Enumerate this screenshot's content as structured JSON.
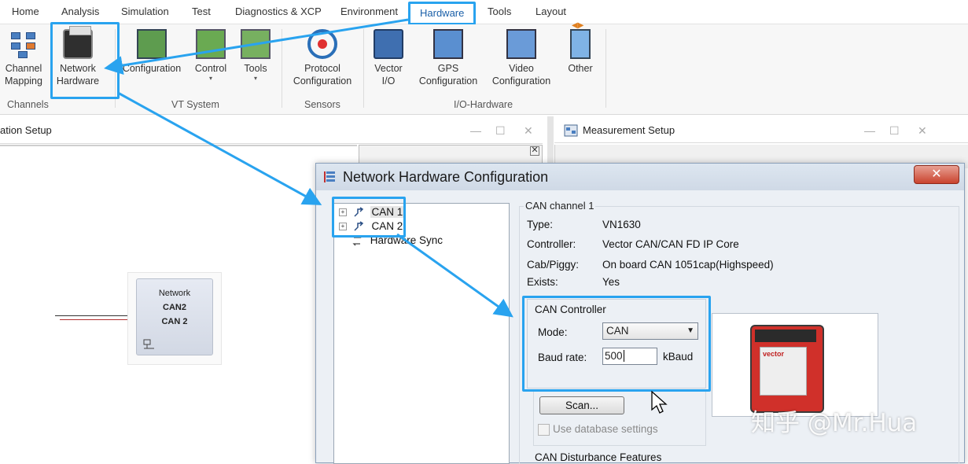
{
  "menu": {
    "items": [
      "Home",
      "Analysis",
      "Simulation",
      "Test",
      "Diagnostics & XCP",
      "Environment",
      "Hardware",
      "Tools",
      "Layout"
    ],
    "active": "Hardware"
  },
  "ribbon": {
    "channel_mapping": [
      "Channel",
      "Mapping"
    ],
    "network_hardware": [
      "Network",
      "Hardware"
    ],
    "configuration": "Configuration",
    "control": "Control",
    "tools": "Tools",
    "protocol_configuration": [
      "Protocol",
      "Configuration"
    ],
    "vector_io": [
      "Vector",
      "I/O"
    ],
    "gps_configuration": [
      "GPS",
      "Configuration"
    ],
    "video_configuration": [
      "Video",
      "Configuration"
    ],
    "other": "Other",
    "groups": {
      "channels": "Channels",
      "vt_system": "VT System",
      "sensors": "Sensors",
      "io_hardware": "I/O-Hardware"
    },
    "dropdown_caret": "▾"
  },
  "windows": {
    "simulation_setup_title": "ation Setup",
    "measurement_setup_title": "Measurement Setup",
    "min": "—",
    "max": "☐",
    "close": "✕"
  },
  "node": {
    "label": "Network",
    "line1": "CAN2",
    "line2": "CAN 2"
  },
  "dialog": {
    "title": "Network Hardware Configuration",
    "close": "✕",
    "tree": [
      {
        "label": "CAN 1",
        "expander": "+"
      },
      {
        "label": "CAN 2",
        "expander": "+"
      },
      {
        "label": "Hardware Sync"
      }
    ],
    "section_title": "CAN channel 1",
    "properties": [
      {
        "key": "Type:",
        "value": "VN1630"
      },
      {
        "key": "Controller:",
        "value": "Vector CAN/CAN FD IP Core"
      },
      {
        "key": "Cab/Piggy:",
        "value": "On board CAN 1051cap(Highspeed)"
      },
      {
        "key": "Exists:",
        "value": "Yes"
      }
    ],
    "can_controller": {
      "title": "CAN Controller",
      "mode_label": "Mode:",
      "mode_value": "CAN",
      "baud_label": "Baud rate:",
      "baud_value": "500",
      "baud_unit": "kBaud"
    },
    "device_logo": "vector",
    "scan_button": "Scan...",
    "use_db": "Use database settings",
    "disturbance": "CAN Disturbance Features"
  },
  "watermark": "知乎 @Mr.Hua",
  "colors": {
    "highlight": "#29a3ef",
    "device": "#d0302a"
  },
  "icons": [
    "channel-mapping-icon",
    "network-hardware-icon",
    "configuration-icon",
    "control-icon",
    "tools-icon",
    "protocol-icon",
    "vector-io-icon",
    "gps-icon",
    "video-icon",
    "other-icon",
    "tree-channel-icon",
    "hardware-sync-icon",
    "dialog-icon",
    "mouse-cursor-icon"
  ]
}
